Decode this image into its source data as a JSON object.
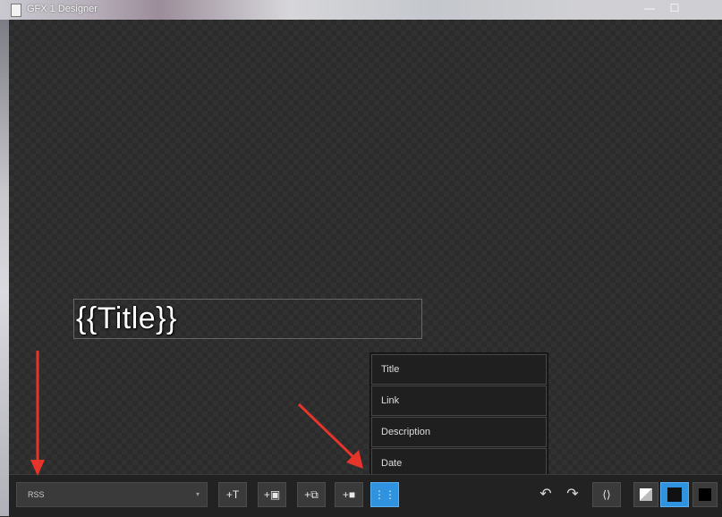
{
  "window": {
    "title": "GFX 1 Designer",
    "minimize": "—",
    "maximize": "☐"
  },
  "canvas": {
    "layer_text": "{{Title}}"
  },
  "dropdown": {
    "items": [
      "Title",
      "Link",
      "Description",
      "Date"
    ]
  },
  "toolbar": {
    "source_value": "RSS",
    "source_arrow": "▾",
    "add_text_icon": "+T",
    "add_image_icon": "+▣",
    "add_slideshow_icon": "+⧉",
    "add_video_icon": "+■",
    "data_field_icon": "⋮⋮",
    "undo_icon": "↶",
    "redo_icon": "↷",
    "fit_icon": "⟨⟩"
  },
  "annotations": {
    "arrow_color": "#e5352b"
  },
  "colors": {
    "accent": "#2f93e0"
  }
}
